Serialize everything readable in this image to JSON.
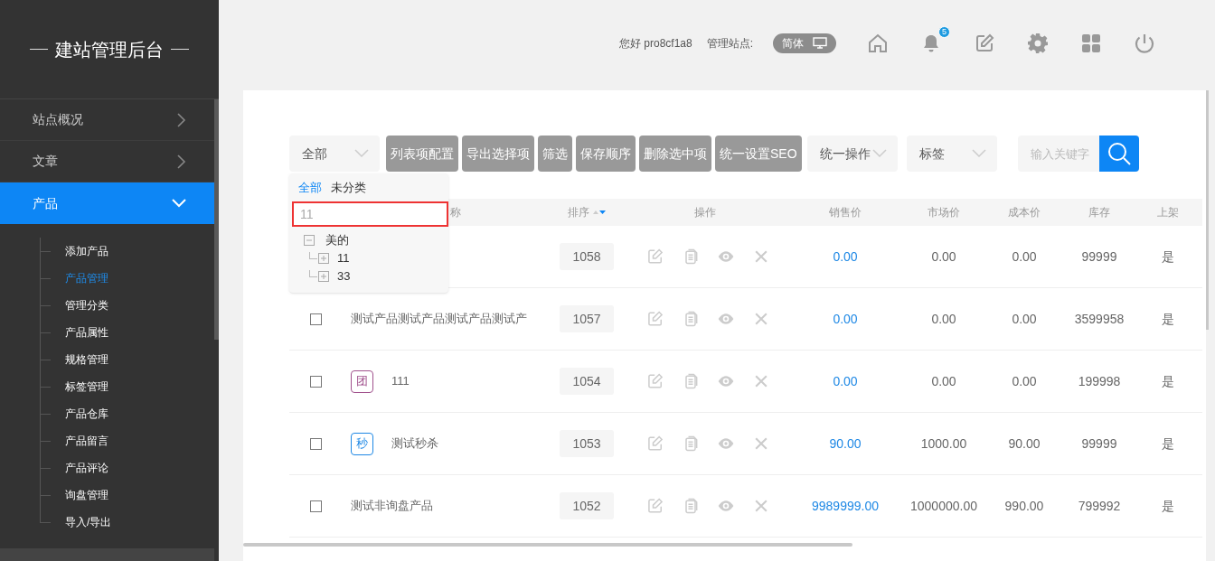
{
  "sidebar": {
    "title": "建站管理后台",
    "menu": [
      {
        "label": "站点概况",
        "selected": false,
        "expanded": false
      },
      {
        "label": "文章",
        "selected": false,
        "expanded": false
      },
      {
        "label": "产品",
        "selected": true,
        "expanded": true,
        "children": [
          {
            "label": "添加产品",
            "selected": false
          },
          {
            "label": "产品管理",
            "selected": true
          },
          {
            "label": "管理分类",
            "selected": false
          },
          {
            "label": "产品属性",
            "selected": false
          },
          {
            "label": "规格管理",
            "selected": false
          },
          {
            "label": "标签管理",
            "selected": false
          },
          {
            "label": "产品仓库",
            "selected": false
          },
          {
            "label": "产品留言",
            "selected": false
          },
          {
            "label": "产品评论",
            "selected": false
          },
          {
            "label": "询盘管理",
            "selected": false
          },
          {
            "label": "导入/导出",
            "selected": false
          }
        ]
      }
    ]
  },
  "header": {
    "greeting": "您好 pro8cf1a8",
    "site_label": "管理站点:",
    "language": "简体",
    "notification_count": "5"
  },
  "toolbar": {
    "category_select": "全部",
    "buttons": [
      "列表项配置",
      "导出选择项",
      "筛选",
      "保存顺序",
      "删除选中项",
      "统一设置SEO"
    ],
    "selects": [
      "统一操作",
      "标签"
    ],
    "search": {
      "placeholder": "输入关键字"
    }
  },
  "category_dropdown": {
    "tabs": [
      {
        "label": "全部",
        "selected": true
      },
      {
        "label": "未分类",
        "selected": false
      }
    ],
    "filter_value": "11",
    "tree": [
      {
        "label": "美的",
        "expanded": true,
        "children": [
          {
            "label": "11",
            "expanded": false
          },
          {
            "label": "33",
            "expanded": false
          }
        ]
      }
    ]
  },
  "table": {
    "columns": [
      "称",
      "排序",
      "操作",
      "销售价",
      "市场价",
      "成本价",
      "库存",
      "上架"
    ],
    "rows": [
      {
        "sort": "1058",
        "sale_price": "0.00",
        "market_price": "0.00",
        "cost_price": "0.00",
        "stock": "99999",
        "listed": "是"
      },
      {
        "checked": false,
        "name": "测试产品测试产品测试产品测试产",
        "sort": "1057",
        "sale_price": "0.00",
        "market_price": "0.00",
        "cost_price": "0.00",
        "stock": "3599958",
        "listed": "是"
      },
      {
        "checked": false,
        "badge": {
          "text": "团",
          "color": "#a0508c"
        },
        "name": "111",
        "sort": "1054",
        "sale_price": "0.00",
        "market_price": "0.00",
        "cost_price": "0.00",
        "stock": "199998",
        "listed": "是"
      },
      {
        "checked": false,
        "badge": {
          "text": "秒",
          "color": "#1e88e5"
        },
        "name": "测试秒杀",
        "sort": "1053",
        "sale_price": "90.00",
        "market_price": "1000.00",
        "cost_price": "90.00",
        "stock": "99999",
        "listed": "是"
      },
      {
        "checked": false,
        "name": "测试非询盘产品",
        "sort": "1052",
        "sale_price": "9989999.00",
        "market_price": "1000000.00",
        "cost_price": "990.00",
        "stock": "799992",
        "listed": "是"
      }
    ]
  }
}
